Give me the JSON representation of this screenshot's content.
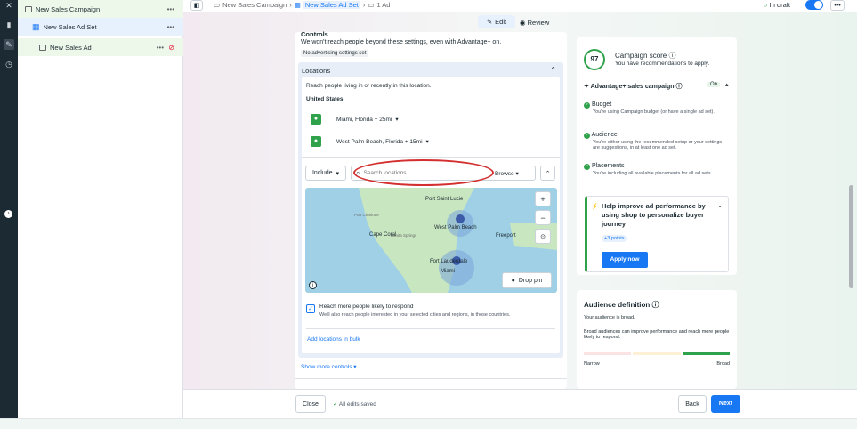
{
  "sidebar": {
    "campaign": "New Sales Campaign",
    "adset": "New Sales Ad Set",
    "ad": "New Sales Ad"
  },
  "topbar": {
    "breadcrumb_campaign": "New Sales Campaign",
    "breadcrumb_adset": "New Sales Ad Set",
    "breadcrumb_ad": "1 Ad",
    "status": "In draft",
    "edit": "Edit",
    "review": "Review"
  },
  "controls": {
    "title": "Controls",
    "note": "We won't reach people beyond these settings, even with Advantage+ on.",
    "badge": "No advertising settings set"
  },
  "locations": {
    "header": "Locations",
    "reach_text": "Reach people living in or recently in this location.",
    "country": "United States",
    "items": [
      "Miami, Florida + 25mi",
      "West Palm Beach, Florida + 15mi"
    ],
    "include": "Include",
    "search_placeholder": "Search locations",
    "browse": "Browse",
    "drop_pin": "Drop pin",
    "map_labels": [
      "Port Saint Lucie",
      "Port Charlotte",
      "West Palm Beach",
      "Cape Coral",
      "Bonita Springs",
      "Freeport",
      "Fort Lauderdale",
      "Miami"
    ],
    "reach_more_title": "Reach more people likely to respond",
    "reach_more_desc": "We'll also reach people interested in your selected cities and regions, in those countries.",
    "add_bulk": "Add locations in bulk",
    "show_more": "Show more controls"
  },
  "score": {
    "value": "97",
    "title": "Campaign score",
    "subtitle": "You have recommendations to apply.",
    "advantage": "Advantage+ sales campaign",
    "on": "On",
    "items": [
      {
        "title": "Budget",
        "desc": "You're using Campaign budget (or have a single ad set)."
      },
      {
        "title": "Audience",
        "desc": "You're either using the recommended setup or your settings are suggestions, in at least one ad set."
      },
      {
        "title": "Placements",
        "desc": "You're including all available placements for all ad sets."
      }
    ],
    "tip_title": "Help improve ad performance by using shop to personalize buyer journey",
    "tip_points": "+3 points",
    "apply": "Apply now"
  },
  "audience": {
    "title": "Audience definition",
    "broad": "Your audience is broad.",
    "desc": "Broad audiences can improve performance and reach more people likely to respond.",
    "narrow": "Narrow",
    "broad_label": "Broad"
  },
  "bottom": {
    "close": "Close",
    "saved": "All edits saved",
    "back": "Back",
    "next": "Next"
  },
  "colors": {
    "accent": "#1877f2",
    "dark": "#1c2b33",
    "green": "#31a24c",
    "annotation": "#d32f2f"
  }
}
